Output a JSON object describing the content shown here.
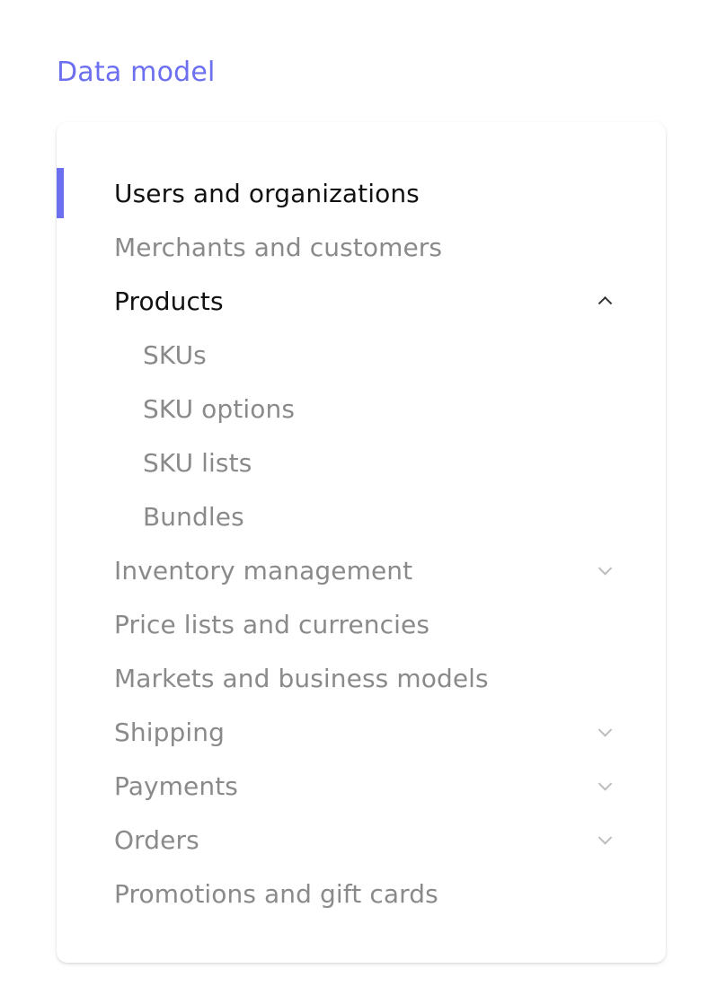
{
  "section_title": "Data model",
  "nav": {
    "items": [
      {
        "label": "Users and organizations",
        "state": "active"
      },
      {
        "label": "Merchants and customers"
      },
      {
        "label": "Products",
        "state": "expanded",
        "icon": "chevron-up-icon"
      },
      {
        "label": "SKUs",
        "level": 2
      },
      {
        "label": "SKU options",
        "level": 2
      },
      {
        "label": "SKU lists",
        "level": 2
      },
      {
        "label": "Bundles",
        "level": 2
      },
      {
        "label": "Inventory management",
        "icon": "chevron-down-icon"
      },
      {
        "label": "Price lists and currencies"
      },
      {
        "label": "Markets and business models"
      },
      {
        "label": "Shipping",
        "icon": "chevron-down-icon"
      },
      {
        "label": "Payments",
        "icon": "chevron-down-icon"
      },
      {
        "label": "Orders",
        "icon": "chevron-down-icon"
      },
      {
        "label": "Promotions and gift cards"
      }
    ]
  },
  "colors": {
    "accent": "#6b6ff0",
    "active_text": "#111111",
    "inactive_text": "#8a8a8a",
    "chevron": "#bdbdbd"
  }
}
